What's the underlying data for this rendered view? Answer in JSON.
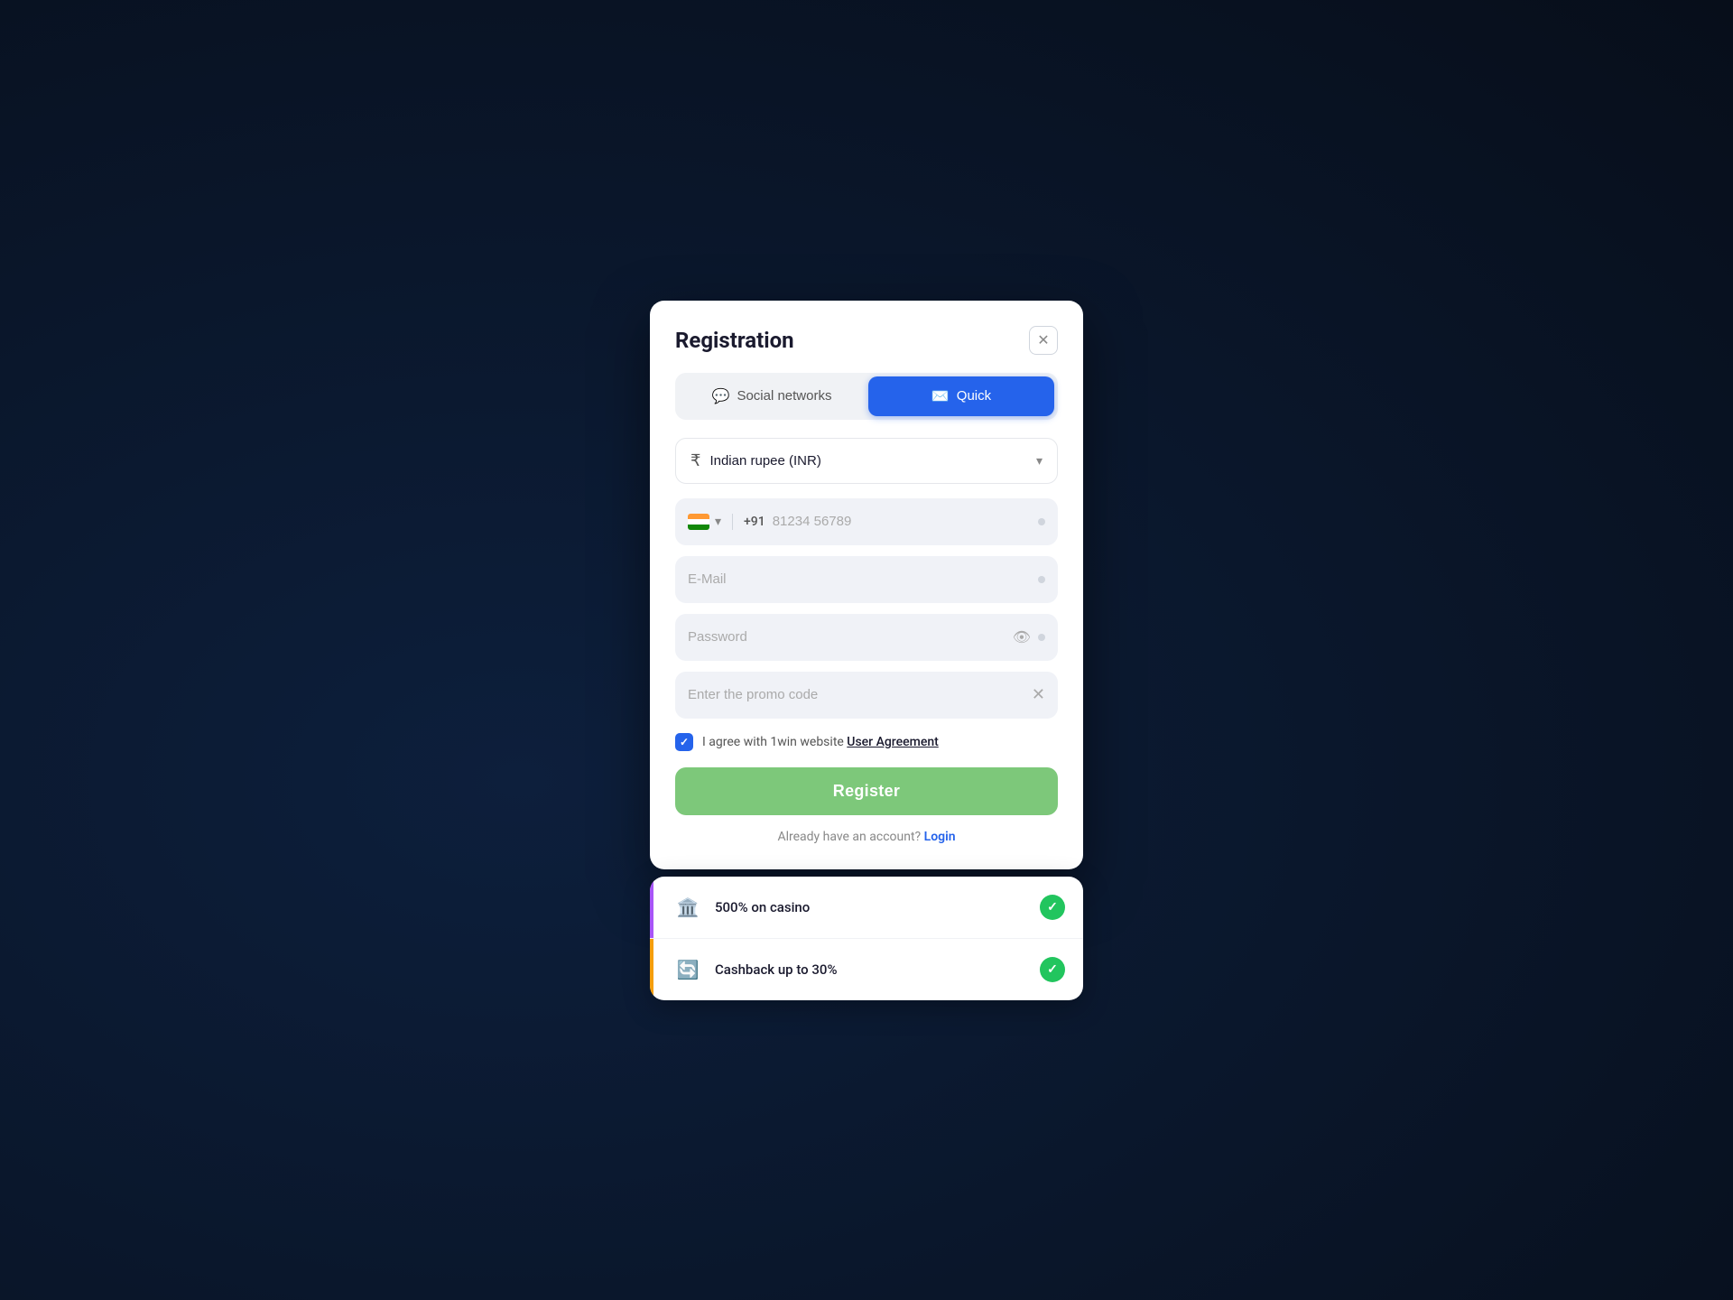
{
  "background": {
    "color": "#0a1628"
  },
  "modal": {
    "title": "Registration",
    "close_label": "×",
    "tabs": [
      {
        "id": "social",
        "label": "Social networks",
        "icon": "💬",
        "active": false
      },
      {
        "id": "quick",
        "label": "Quick",
        "icon": "✉️",
        "active": true
      }
    ],
    "currency": {
      "symbol": "₹",
      "label": "Indian rupee (INR)"
    },
    "phone": {
      "country_code": "+91",
      "placeholder": "81234 56789",
      "required": true
    },
    "email": {
      "placeholder": "E-Mail",
      "required": true
    },
    "password": {
      "placeholder": "Password",
      "required": true
    },
    "promo": {
      "placeholder": "Enter the promo code"
    },
    "agreement": {
      "text": "I agree with 1win website ",
      "link_text": "User Agreement",
      "checked": true
    },
    "register_btn": "Register",
    "login_prompt": "Already have an account?",
    "login_link": "Login"
  },
  "bonuses": [
    {
      "id": "casino",
      "icon": "🏛️",
      "label": "500% on casino",
      "accent_color": "#a855f7",
      "checked": true
    },
    {
      "id": "cashback",
      "icon": "🔄",
      "label": "Cashback up to 30%",
      "accent_color": "#f59e0b",
      "checked": true
    }
  ]
}
